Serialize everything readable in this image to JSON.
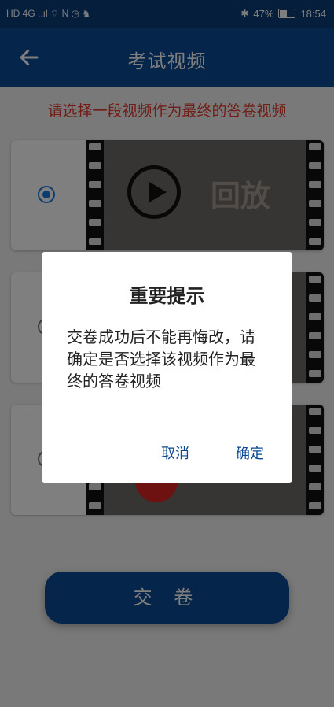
{
  "status": {
    "left_icons": "HD 4G ..ıl ⌔ N ◷ ♞",
    "bluetooth": "✱",
    "battery_pct": "47%",
    "time": "18:54"
  },
  "appbar": {
    "title": "考试视频"
  },
  "prompt": "请选择一段视频作为最终的答卷视频",
  "videos": [
    {
      "label": "回放"
    },
    {
      "label": ""
    },
    {
      "label": ""
    }
  ],
  "submit_label": "交 卷",
  "dialog": {
    "title": "重要提示",
    "message": "交卷成功后不能再悔改，请确定是否选择该视频作为最终的答卷视频",
    "cancel": "取消",
    "ok": "确定"
  },
  "colors": {
    "primary": "#0a4a94",
    "prompt": "#e23b2f",
    "radio": "#1a7be0"
  }
}
